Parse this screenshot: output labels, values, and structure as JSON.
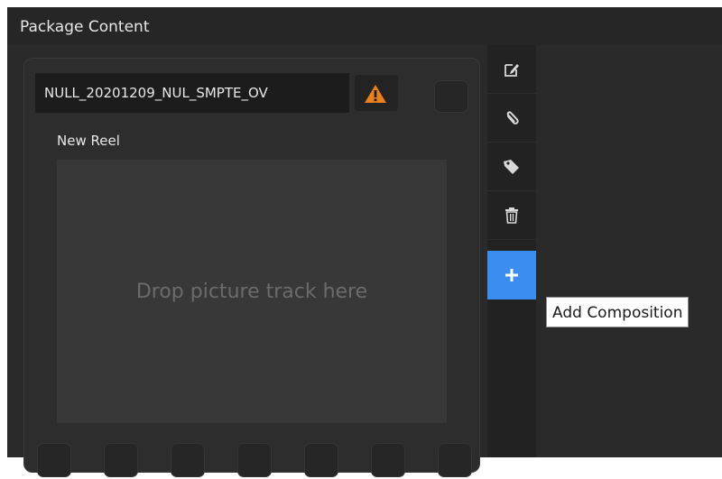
{
  "window": {
    "title": "Package Content"
  },
  "composition": {
    "name": "NULL_20201209_NUL_SMPTE_OV",
    "reel_label": "New Reel",
    "drop_placeholder": "Drop picture track here"
  },
  "toolbar": {
    "buttons": [
      {
        "icon": "edit-icon"
      },
      {
        "icon": "paperclip-icon"
      },
      {
        "icon": "tag-icon"
      },
      {
        "icon": "trash-icon"
      },
      {
        "icon": "plus-icon"
      }
    ]
  },
  "tooltip": {
    "text": "Add Composition"
  },
  "colors": {
    "accent": "#3b8ef0",
    "warning": "#e8801e",
    "background": "#2a2a2a"
  }
}
